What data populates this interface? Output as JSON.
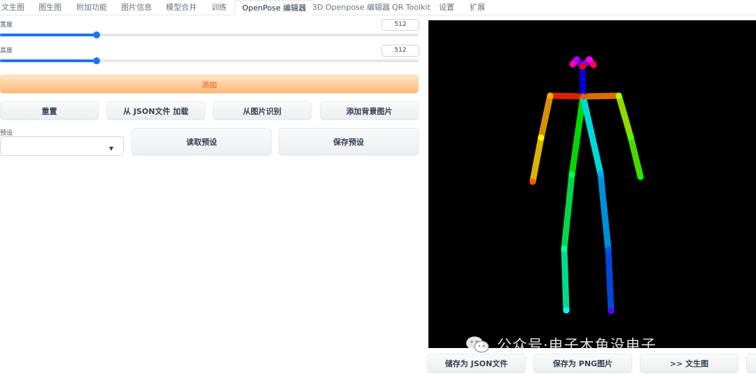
{
  "tabs": [
    "文生图",
    "图生图",
    "附加功能",
    "图片信息",
    "模型合并",
    "训练",
    "OpenPose 编辑器",
    "3D Openpose 编辑器",
    "QR Toolkit",
    "设置",
    "扩展"
  ],
  "active_tab_index": 6,
  "width": {
    "label": "宽度",
    "value": "512",
    "slider_fraction": 0.23
  },
  "height": {
    "label": "高度",
    "value": "512",
    "slider_fraction": 0.23
  },
  "add_button": "添加",
  "action_buttons": {
    "reset": "重置",
    "load_json": "从 JSON文件 加载",
    "detect_from_image": "从图片识别",
    "add_background": "添加背景图片"
  },
  "preset": {
    "label": "预设",
    "value": ""
  },
  "preset_buttons": {
    "read": "读取预设",
    "save": "保存预设"
  },
  "bottom_buttons": {
    "save_json": "储存为 JSON文件",
    "save_png": "保存为 PNG图片",
    "to_txt2img": ">> 文生图"
  },
  "watermark": "公众号·电子木鱼没电子",
  "colors": {
    "accent": "#1d74f5",
    "primary_text": "#e8590c",
    "canvas_bg": "#000000"
  },
  "icons": {
    "dropdown": "chevron-down-icon",
    "watermark": "wechat-icon"
  }
}
